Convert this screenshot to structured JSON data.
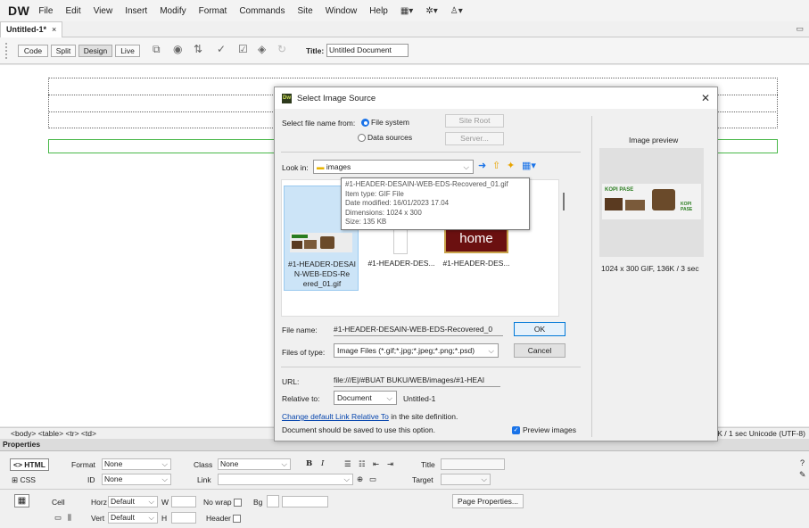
{
  "app": {
    "logo": "DW",
    "menu": [
      "File",
      "Edit",
      "View",
      "Insert",
      "Modify",
      "Format",
      "Commands",
      "Site",
      "Window",
      "Help"
    ],
    "menu_icons": [
      "▦▾",
      "✲▾",
      "♙▾"
    ]
  },
  "doc_tab": {
    "label": "Untitled-1*",
    "close": "×"
  },
  "toolbar": {
    "views": [
      "Code",
      "Split",
      "Design",
      "Live"
    ],
    "title_label": "Title:",
    "title_value": "Untitled Document"
  },
  "status": {
    "tags": "<body> <table> <tr> <td>",
    "right": "K / 1 sec  Unicode (UTF-8)"
  },
  "properties": {
    "header": "Properties",
    "html_btn": "<> HTML",
    "css_btn": "CSS",
    "format_label": "Format",
    "format_value": "None",
    "class_label": "Class",
    "class_value": "None",
    "id_label": "ID",
    "id_value": "None",
    "link_label": "Link",
    "title_label": "Title",
    "target_label": "Target",
    "cell_label": "Cell",
    "horz_label": "Horz",
    "horz_value": "Default",
    "vert_label": "Vert",
    "vert_value": "Default",
    "w_label": "W",
    "h_label": "H",
    "nowrap_label": "No wrap",
    "bg_label": "Bg",
    "header_label": "Header",
    "page_props": "Page Properties..."
  },
  "dialog": {
    "title": "Select Image Source",
    "select_from": "Select file name from:",
    "file_system": "File system",
    "data_sources": "Data sources",
    "site_root": "Site Root",
    "server": "Server...",
    "look_in_label": "Look in:",
    "look_in_value": "images",
    "files": [
      {
        "name": "#1-HEADER-DESAIN-WEB-EDS-Recovered_01.gif",
        "label_lines": [
          "#1-HEADER-DESAI",
          "N-WEB-EDS-Re",
          "ered_01.gif"
        ]
      },
      {
        "name": "#1-HEADER-DES...",
        "label_lines": [
          "#1-HEADER-DES..."
        ]
      },
      {
        "name": "#1-HEADER-DES...",
        "label_lines": [
          "#1-HEADER-DES..."
        ],
        "thumb_text": "home"
      }
    ],
    "tooltip": [
      "#1-HEADER-DESAIN-WEB-EDS-Recovered_01.gif",
      "Item type: GIF File",
      "Date modified: 16/01/2023 17.04",
      "Dimensions: 1024 x 300",
      "Size: 135 KB"
    ],
    "preview_label": "Image preview",
    "preview_info": "1024 x 300 GIF, 136K / 3 sec",
    "filename_label": "File name:",
    "filename_value": "#1-HEADER-DESAIN-WEB-EDS-Recovered_0",
    "ok": "OK",
    "filetype_label": "Files of type:",
    "filetype_value": "Image Files (*.gif;*.jpg;*.jpeg;*.png;*.psd)",
    "cancel": "Cancel",
    "url_label": "URL:",
    "url_value": "file:///E|/#BUAT BUKU/WEB/images/#1-HEAI",
    "relative_label": "Relative to:",
    "relative_value": "Document",
    "relative_doc": "Untitled-1",
    "change_link": "Change default Link Relative To",
    "change_rest": " in the site definition.",
    "save_note": "Document should be saved to use this option.",
    "preview_images": "Preview images",
    "banner_text": "KOPI PASE",
    "banner_small": "KOPI PASE"
  }
}
